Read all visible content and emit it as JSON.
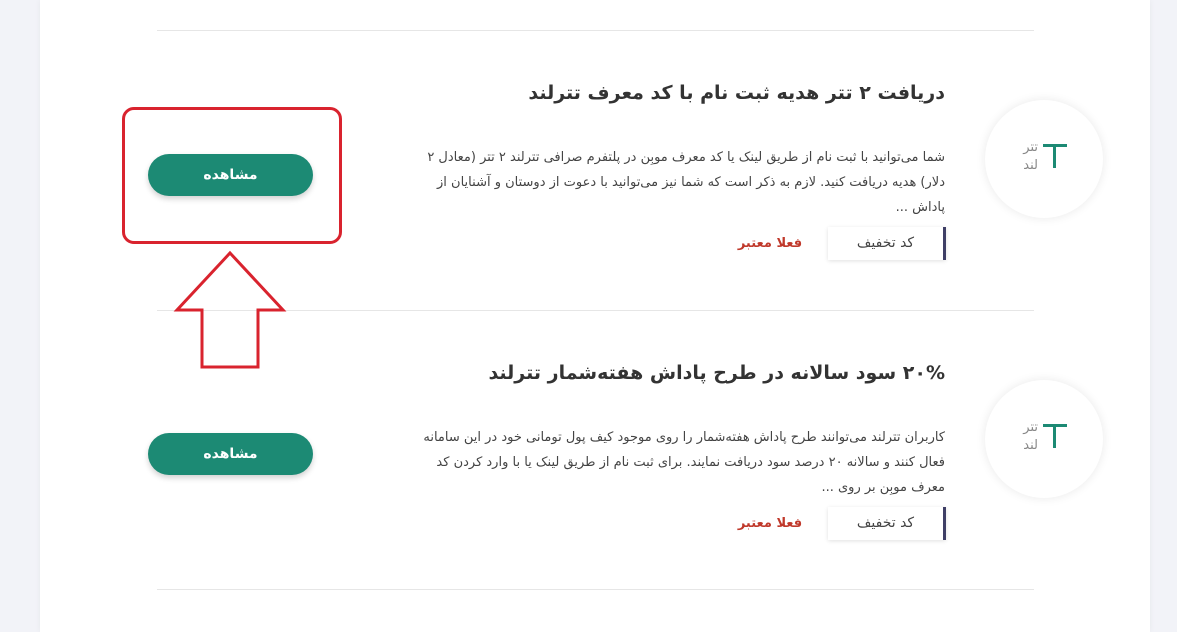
{
  "colors": {
    "accent": "#1c8a74",
    "status": "#c0392b",
    "highlight": "#d9232e"
  },
  "offers": [
    {
      "title": "دریافت ۲ تتر هدیه ثبت نام با کد معرف تترلند",
      "description": "شما می‌توانید با ثبت نام از طریق لینک یا کد معرف موبِن در پلتفرم صرافی تترلند ۲ تتر (معادل ۲ دلار) هدیه دریافت کنید. لازم به ذکر است که شما نیز می‌توانید با دعوت از دوستان و آشنایان از پاداش ...",
      "code_label": "کد تخفیف",
      "status": "فعلا معتبر",
      "view_label": "مشاهده",
      "logo": {
        "line1": "تتر",
        "line2": "لند",
        "icon": "tetherland-logo-icon"
      }
    },
    {
      "title": "۲۰% سود سالانه در طرح پاداش هفته‌شمار تترلند",
      "description": "کاربران تترلند می‌توانند طرح پاداش هفته‌شمار را روی موجود کیف پول تومانی خود در این سامانه فعال کنند و سالانه ۲۰ درصد سود دریافت نمایند. برای ثبت نام از طریق لینک یا با وارد کردن کد معرف موبِن بر روی ...",
      "code_label": "کد تخفیف",
      "status": "فعلا معتبر",
      "view_label": "مشاهده",
      "logo": {
        "line1": "تتر",
        "line2": "لند",
        "icon": "tetherland-logo-icon"
      }
    }
  ]
}
